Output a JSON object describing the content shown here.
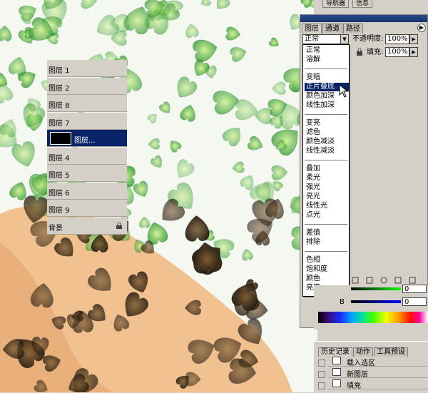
{
  "top_tabs": [
    "导航器",
    "信息"
  ],
  "layers_panel": {
    "tabs": [
      "图层",
      "通道",
      "路径"
    ],
    "active_tab": "图层",
    "menu_arrow": "▶",
    "blend_mode_value": "正常",
    "opacity_label": "不透明度:",
    "opacity_value": "100%",
    "lock_label": "锁",
    "fill_label": "填充:",
    "fill_value": "100%",
    "layers": [
      {
        "name": "图层 1",
        "selected": false
      },
      {
        "name": "图层 2",
        "selected": false
      },
      {
        "name": "图层 8",
        "selected": false
      },
      {
        "name": "图层 7",
        "selected": false
      },
      {
        "name": "图层...",
        "selected": true
      },
      {
        "name": "图层 4",
        "selected": false
      },
      {
        "name": "图层 5",
        "selected": false
      },
      {
        "name": "图层 6",
        "selected": false
      },
      {
        "name": "图层 9",
        "selected": false
      },
      {
        "name": "背景",
        "selected": false
      }
    ]
  },
  "blend_menu": {
    "groups": [
      [
        "正常",
        "溶解"
      ],
      [
        "变暗",
        "正片叠底",
        "颜色加深",
        "线性加深"
      ],
      [
        "变亮",
        "滤色",
        "颜色减淡",
        "线性减淡"
      ],
      [
        "叠加",
        "柔光",
        "强光",
        "亮光",
        "线性光",
        "点光"
      ],
      [
        "差值",
        "排除"
      ],
      [
        "色相",
        "饱和度",
        "颜色",
        "亮度"
      ]
    ],
    "highlighted": "正片叠底"
  },
  "color_panel": {
    "channel_b_label": "B",
    "value_1": "0",
    "value_2": "0"
  },
  "history_panel": {
    "tabs": [
      "历史记录",
      "动作",
      "工具预设"
    ],
    "active_tab": "历史记录",
    "items": [
      "载入选区",
      "新图层",
      "填充"
    ]
  },
  "colors": {
    "panel_bg": "#d4d0c8",
    "selection": "#0a246a",
    "leaf_green": "#3aa82a",
    "skin": "#f2c190"
  },
  "icons": [
    "eye-icon",
    "lock-icon",
    "menu-arrow-icon",
    "cursor-arrow-icon",
    "history-snapshot-icon"
  ]
}
